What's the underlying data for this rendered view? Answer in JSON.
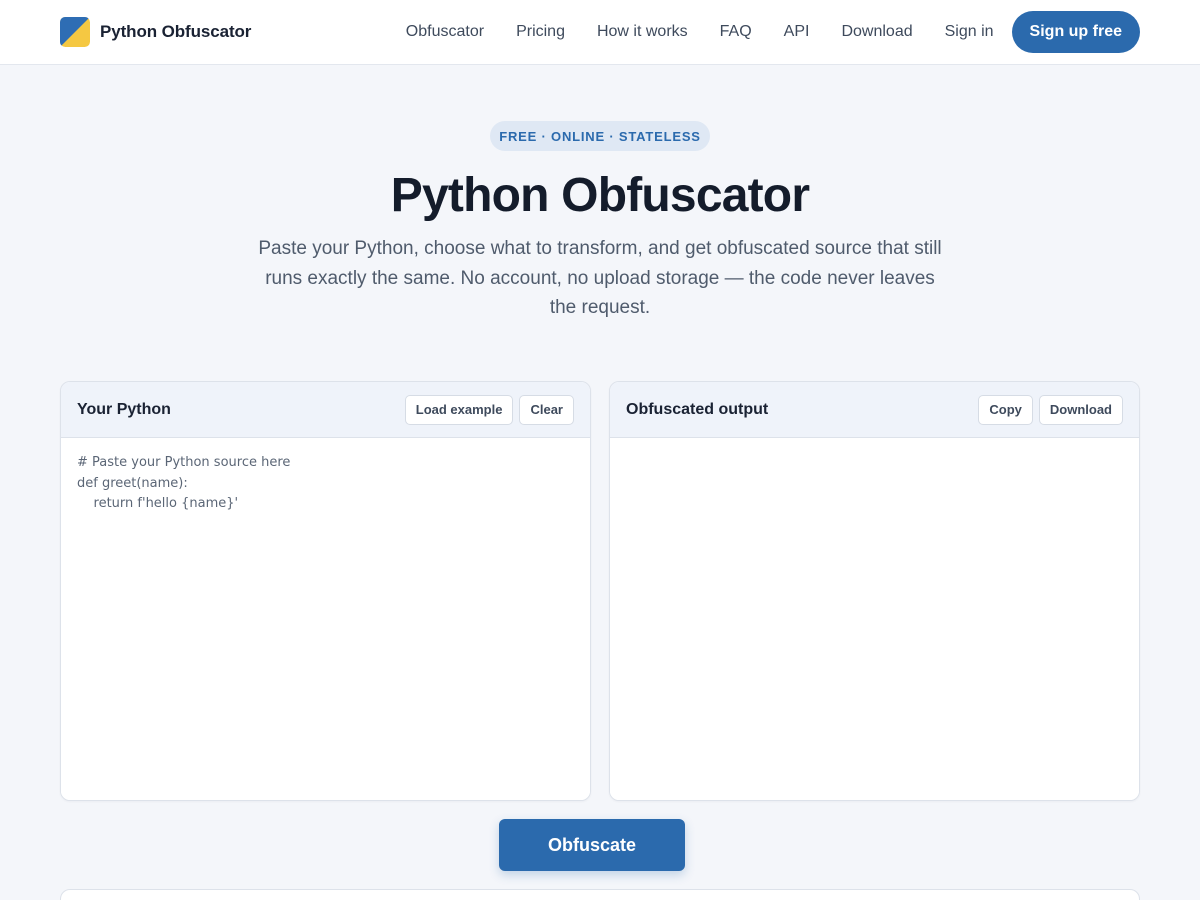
{
  "header": {
    "brand": "Python Obfuscator",
    "logo_icon": "python-obfuscator-logo-icon",
    "nav": [
      "Obfuscator",
      "Pricing",
      "How it works",
      "FAQ",
      "API",
      "Download",
      "Sign in"
    ],
    "signup_label": "Sign up free"
  },
  "hero": {
    "badge": "FREE · ONLINE · STATELESS",
    "title": "Python Obfuscator",
    "subtitle": "Paste your Python, choose what to transform, and get obfuscated source that still runs exactly the same. No account, no upload storage — the code never leaves the request."
  },
  "input_panel": {
    "title": "Your Python",
    "load_example_label": "Load example",
    "clear_label": "Clear",
    "placeholder": "# Paste your Python source here\ndef greet(name):\n    return f'hello {name}'",
    "value": ""
  },
  "output_panel": {
    "title": "Obfuscated output",
    "copy_label": "Copy",
    "download_label": "Download",
    "value": ""
  },
  "primary_action_label": "Obfuscate",
  "colors": {
    "accent": "#2b6aad",
    "logo_blue": "#2e6db4",
    "logo_yellow": "#f5c842",
    "page_bg": "#f4f6fa"
  }
}
